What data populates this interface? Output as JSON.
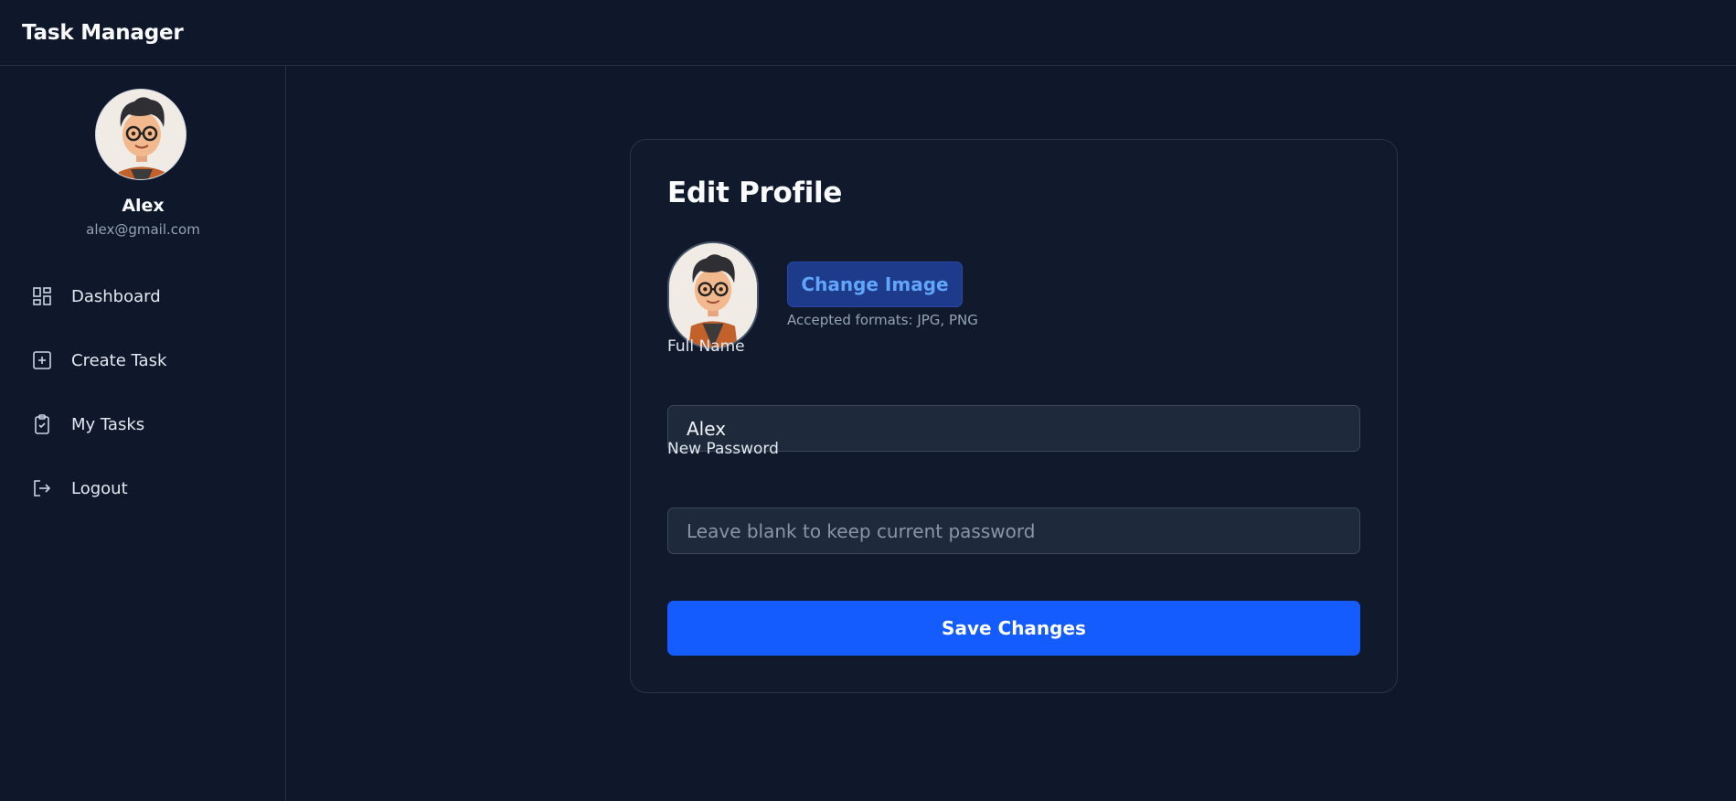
{
  "app": {
    "title": "Task Manager"
  },
  "sidebar": {
    "user": {
      "name": "Alex",
      "email": "alex@gmail.com",
      "avatar": "avatar-image"
    },
    "items": [
      {
        "label": "Dashboard",
        "icon": "dashboard-icon"
      },
      {
        "label": "Create Task",
        "icon": "plus-square-icon"
      },
      {
        "label": "My Tasks",
        "icon": "clipboard-check-icon"
      },
      {
        "label": "Logout",
        "icon": "logout-icon"
      }
    ]
  },
  "profile": {
    "title": "Edit Profile",
    "change_image_label": "Change Image",
    "accepted_formats": "Accepted formats: JPG, PNG",
    "full_name": {
      "label": "Full Name",
      "value": "Alex"
    },
    "new_password": {
      "label": "New Password",
      "value": "",
      "placeholder": "Leave blank to keep current password"
    },
    "save_label": "Save Changes"
  },
  "colors": {
    "background": "#0f172a",
    "accent": "#155cff",
    "change_button_bg": "#1e3a8a",
    "change_button_text": "#60a5fa",
    "input_bg": "#1e293b"
  }
}
